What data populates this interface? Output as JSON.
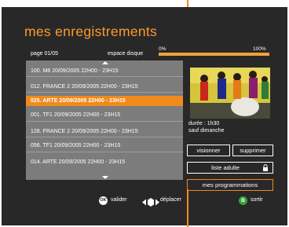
{
  "header": {
    "title": "mes enregistrements",
    "page_info": "page 01/05",
    "disk_label": "espace disque",
    "disk_min": "0%",
    "disk_max": "100%",
    "disk_used_fraction": 1.0
  },
  "recordings": [
    {
      "label": "100.  M6  20/09/2005  22H00 - 23H15",
      "selected": false
    },
    {
      "label": "012.  FRANCE 2  20/09/2005  22H00 - 23H15",
      "selected": false
    },
    {
      "label": "025.  ARTE  20/09/2005  22H00 - 23H15",
      "selected": true
    },
    {
      "label": "001.  TF1  20/09/2005  22H00 - 23H15",
      "selected": false
    },
    {
      "label": "128.  FRANCE 2  20/09/2005  22H00 - 23H15",
      "selected": false
    },
    {
      "label": "056.  TF1  20/09/2005  22H00 - 23H15",
      "selected": false
    },
    {
      "label": "014.  ARTE 20/09/2005    22H00 - 23H15",
      "selected": false
    }
  ],
  "details": {
    "duration": "durée : 1h30",
    "schedule": "sauf dimanche"
  },
  "actions": {
    "view": "visionner",
    "delete": "supprimer",
    "adult_list": "liste adulte",
    "my_schedules": "mes programmations"
  },
  "footer": {
    "ok_key": "OK",
    "validate": "valider",
    "move": "déplacer",
    "b_key": "B",
    "exit": "sortir"
  },
  "colors": {
    "accent": "#f08a1d",
    "background": "#282828",
    "list_bg": "#7c7c7c",
    "green_key": "#3aa33a"
  },
  "icons": [
    "chevron-up-icon",
    "chevron-down-icon",
    "lock-icon",
    "ok-button-icon",
    "navigate-arrows-icon",
    "b-button-icon"
  ]
}
